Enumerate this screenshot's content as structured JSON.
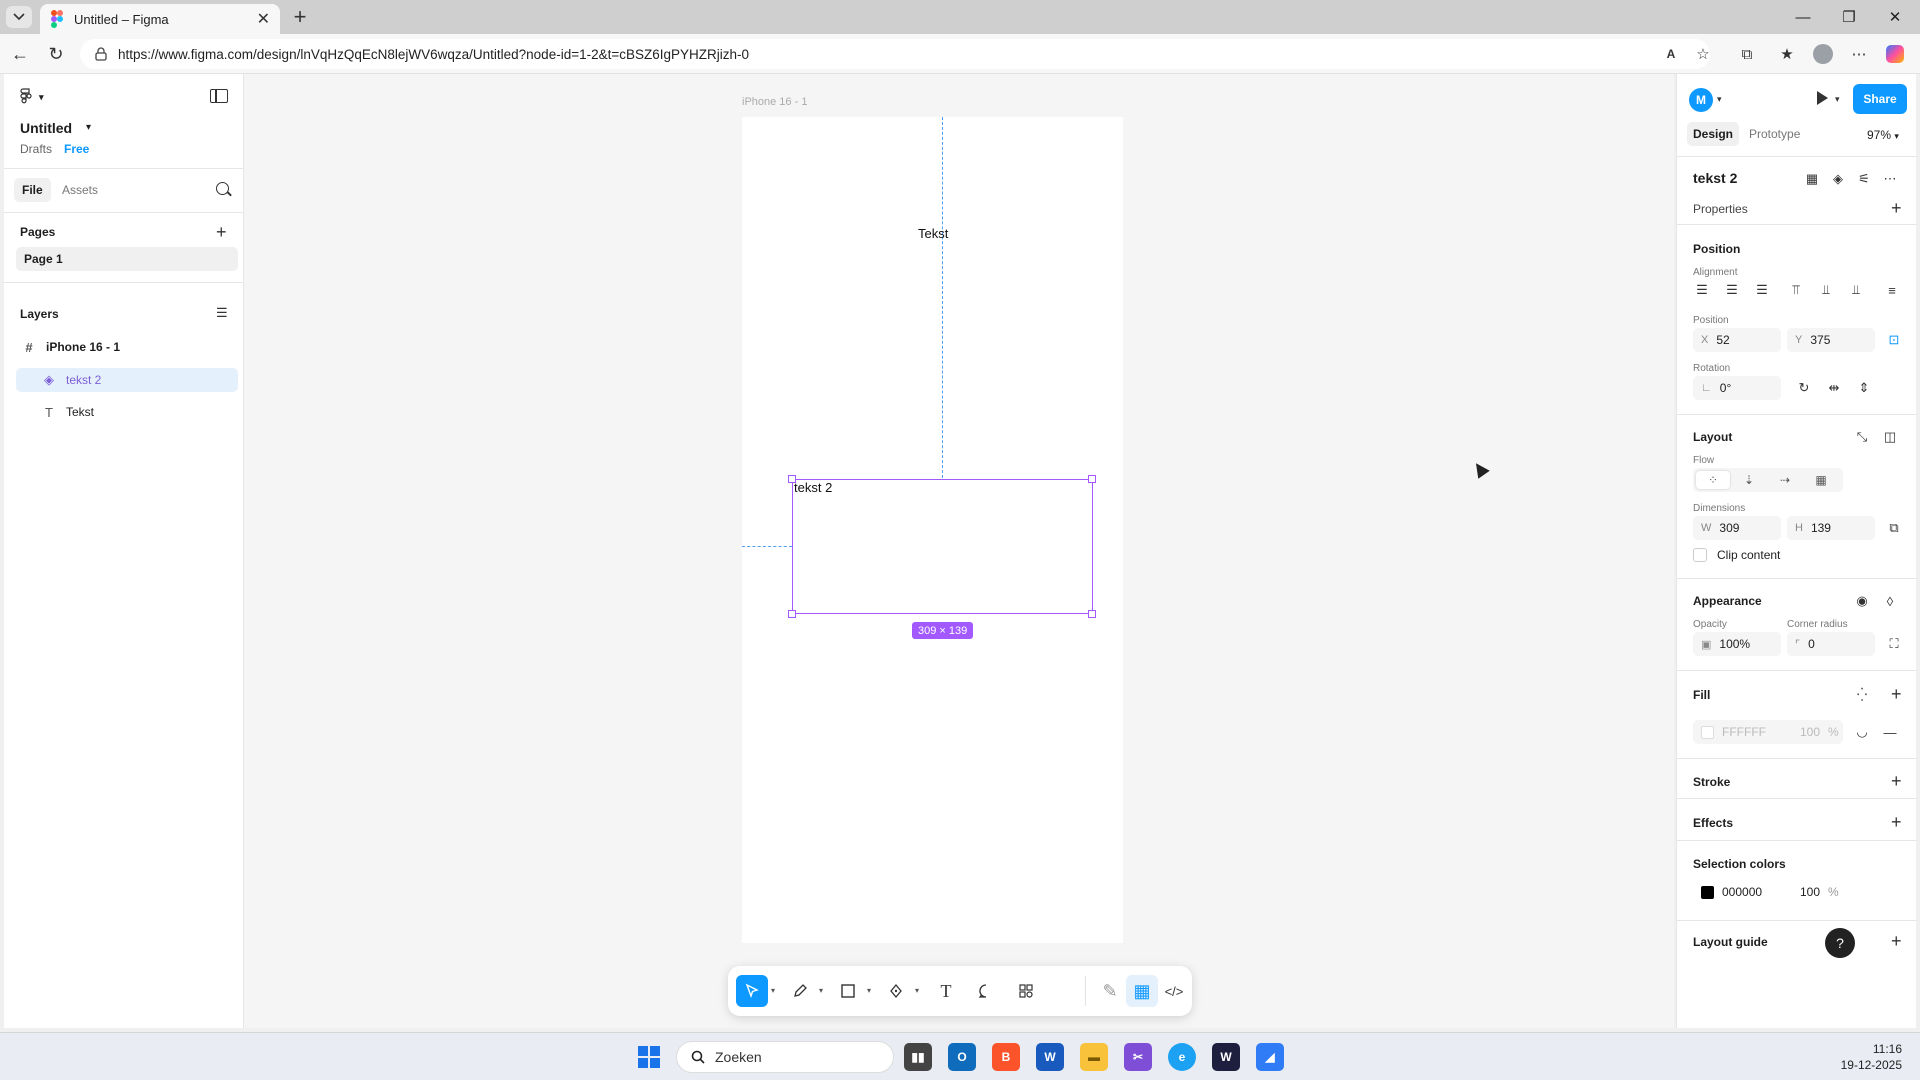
{
  "browser": {
    "tab_title": "Untitled – Figma",
    "url": "https://www.figma.com/design/lnVqHzQqEcN8lejWV6wqza/Untitled?node-id=1-2&t=cBSZ6IgPYHZRjizh-0"
  },
  "left_panel": {
    "file_name": "Untitled",
    "location": "Drafts",
    "plan": "Free",
    "tabs": [
      "File",
      "Assets"
    ],
    "pages_heading": "Pages",
    "pages": [
      "Page 1"
    ],
    "layers_heading": "Layers",
    "layers": [
      {
        "name": "iPhone 16 - 1",
        "icon": "frame-icon"
      },
      {
        "name": "tekst 2",
        "icon": "component-icon"
      },
      {
        "name": "Tekst",
        "icon": "text-icon"
      }
    ]
  },
  "canvas": {
    "frame_label": "iPhone 16 - 1",
    "text_1": "Tekst",
    "text_2": "tekst 2",
    "selection_dims": "309 × 139"
  },
  "right_panel": {
    "avatar_initial": "M",
    "share_label": "Share",
    "tabs": [
      "Design",
      "Prototype"
    ],
    "zoom": "97%",
    "selected_name": "tekst 2",
    "properties_heading": "Properties",
    "position_heading": "Position",
    "alignment_label": "Alignment",
    "position_label": "Position",
    "x_prefix": "X",
    "x_value": "52",
    "y_prefix": "Y",
    "y_value": "375",
    "rotation_label": "Rotation",
    "rotation_value": "0°",
    "layout_heading": "Layout",
    "flow_label": "Flow",
    "dimensions_label": "Dimensions",
    "w_prefix": "W",
    "w_value": "309",
    "h_prefix": "H",
    "h_value": "139",
    "clip_content_label": "Clip content",
    "appearance_heading": "Appearance",
    "opacity_label": "Opacity",
    "opacity_value": "100%",
    "corner_radius_label": "Corner radius",
    "corner_radius_value": "0",
    "fill_heading": "Fill",
    "fill_hex": "FFFFFF",
    "fill_opacity": "100",
    "percent_sign": "%",
    "stroke_heading": "Stroke",
    "effects_heading": "Effects",
    "selection_colors_heading": "Selection colors",
    "selection_color_hex": "000000",
    "selection_color_opacity": "100",
    "layout_guide_heading": "Layout guide",
    "help_label": "?"
  },
  "taskbar": {
    "search_placeholder": "Zoeken",
    "time": "11:16",
    "date": "19-12-2025"
  },
  "colors": {
    "accent": "#0d99ff",
    "selection": "#a259ff",
    "selected_fill": "#000000"
  }
}
